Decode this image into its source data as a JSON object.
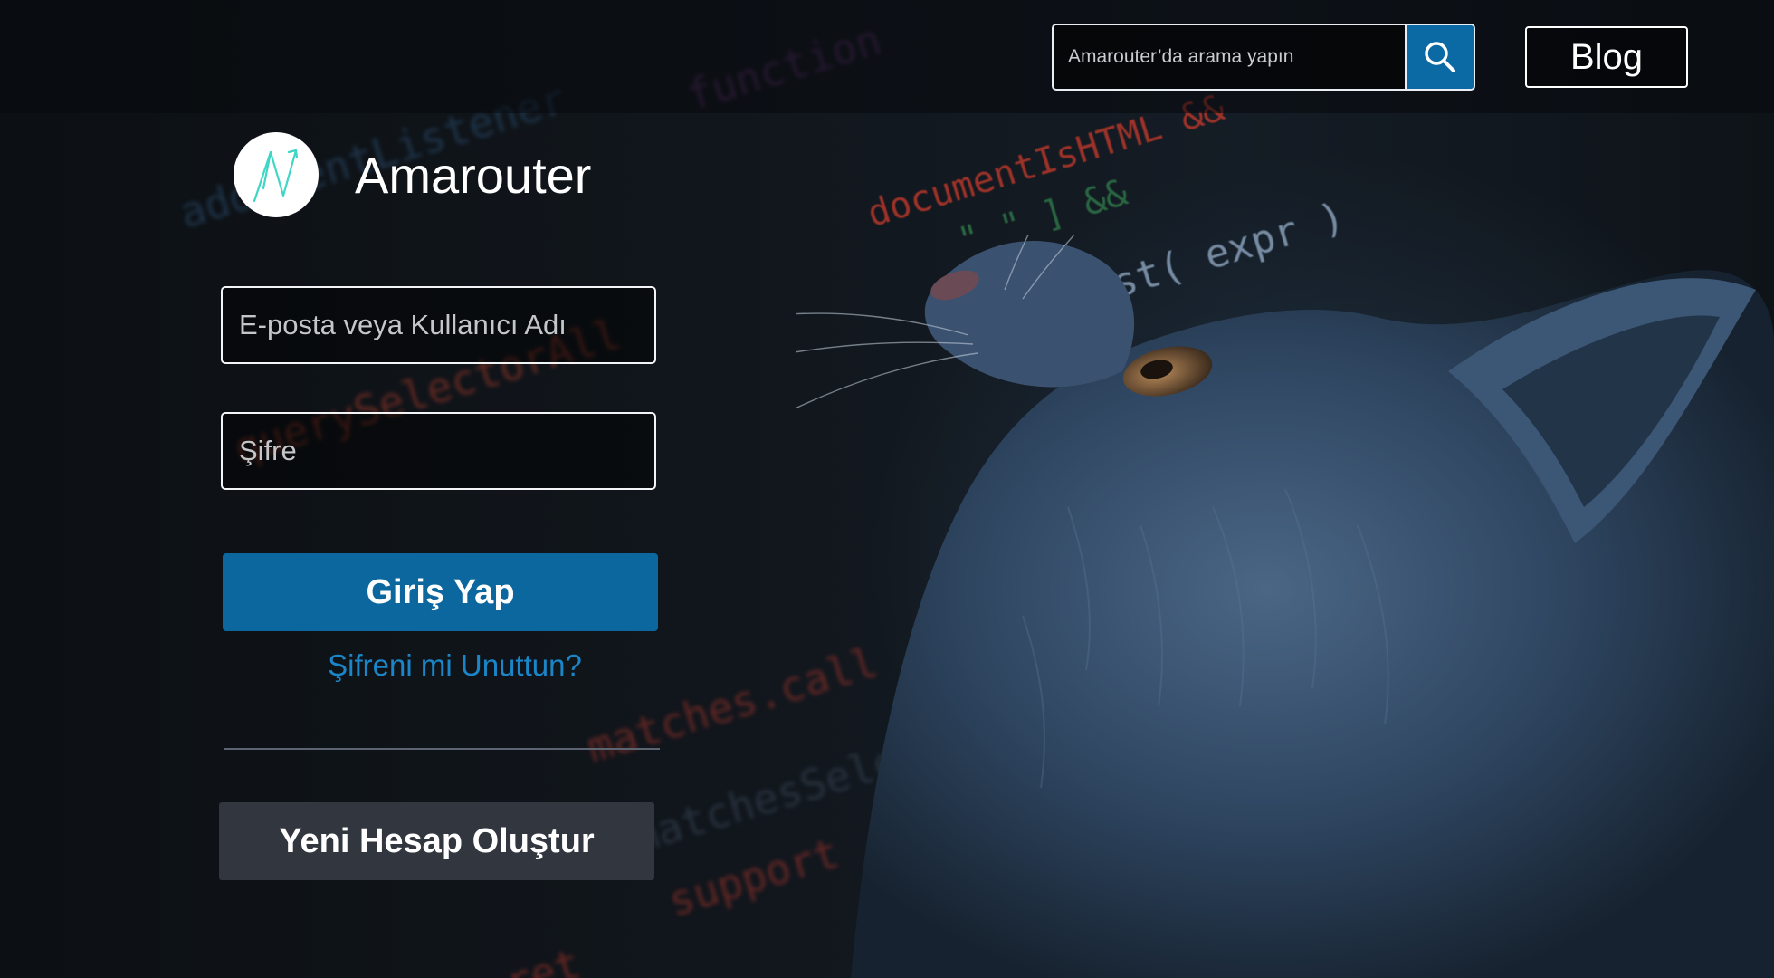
{
  "header": {
    "search": {
      "placeholder": "Amarouter’da arama yapın",
      "icon": "search-icon"
    },
    "blog_label": "Blog"
  },
  "brand": {
    "name": "Amarouter",
    "logo_icon": "amarouter-logo-icon"
  },
  "login_form": {
    "email_placeholder": "E-posta veya Kullanıcı Adı",
    "password_placeholder": "Şifre",
    "submit_label": "Giriş Yap",
    "forgot_label": "Şifreni mi Unuttun?",
    "create_account_label": "Yeni Hesap Oluştur"
  },
  "background": {
    "code_snippets": [
      "function",
      "addEventListener",
      "documentIsHTML &&",
      "\" \" ] &&",
      "test( expr )",
      "querySelectorAll",
      "matches.call",
      "matchesSelector",
      "support",
      "ret"
    ]
  },
  "colors": {
    "accent": "#0b679e",
    "link": "#1a86c7",
    "secondary_button": "#32363f",
    "logo_mark": "#3fd6c6"
  }
}
